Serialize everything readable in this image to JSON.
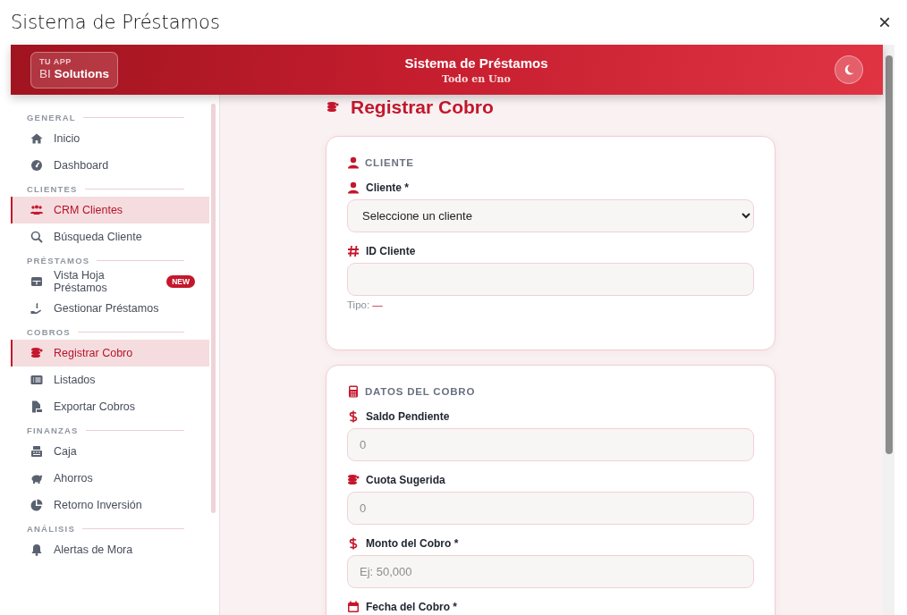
{
  "window": {
    "title": "Sistema de Préstamos",
    "close": "×"
  },
  "header": {
    "logo_small": "TU APP",
    "logo_prefix": "BI",
    "logo_bold": "Solutions",
    "title": "Sistema de Préstamos",
    "subtitle": "Todo en Uno"
  },
  "sidebar": {
    "sections": [
      {
        "title": "GENERAL",
        "items": [
          {
            "label": "Inicio",
            "selected": false
          },
          {
            "label": "Dashboard",
            "selected": false
          }
        ]
      },
      {
        "title": "CLIENTES",
        "items": [
          {
            "label": "CRM Clientes",
            "selected": true
          },
          {
            "label": "Búsqueda Cliente",
            "selected": false
          }
        ]
      },
      {
        "title": "PRÉSTAMOS",
        "items": [
          {
            "label": "Vista Hoja Préstamos",
            "selected": false,
            "badge": "NEW"
          },
          {
            "label": "Gestionar Préstamos",
            "selected": false
          }
        ]
      },
      {
        "title": "COBROS",
        "items": [
          {
            "label": "Registrar Cobro",
            "selected": true
          },
          {
            "label": "Listados",
            "selected": false
          },
          {
            "label": "Exportar Cobros",
            "selected": false
          }
        ]
      },
      {
        "title": "FINANZAS",
        "items": [
          {
            "label": "Caja",
            "selected": false
          },
          {
            "label": "Ahorros",
            "selected": false
          },
          {
            "label": "Retorno Inversión",
            "selected": false
          }
        ]
      },
      {
        "title": "ANÁLISIS",
        "items": [
          {
            "label": "Alertas de Mora",
            "selected": false
          }
        ]
      }
    ]
  },
  "page": {
    "title": "Registrar Cobro",
    "cards": [
      {
        "title": "CLIENTE",
        "fields": [
          {
            "kind": "select",
            "label": "Cliente *",
            "value": "Seleccione un cliente"
          },
          {
            "kind": "input",
            "label": "ID Cliente",
            "hint": {
              "label": "Tipo:",
              "value": "—"
            }
          }
        ]
      },
      {
        "title": "DATOS DEL COBRO",
        "fields": [
          {
            "kind": "input",
            "label": "Saldo Pendiente",
            "placeholder": "0"
          },
          {
            "kind": "input",
            "label": "Cuota Sugerida",
            "placeholder": "0"
          },
          {
            "kind": "input",
            "label": "Monto del Cobro *",
            "placeholder": "Ej: 50,000"
          },
          {
            "kind": "label_only",
            "label": "Fecha del Cobro *"
          }
        ]
      }
    ]
  }
}
